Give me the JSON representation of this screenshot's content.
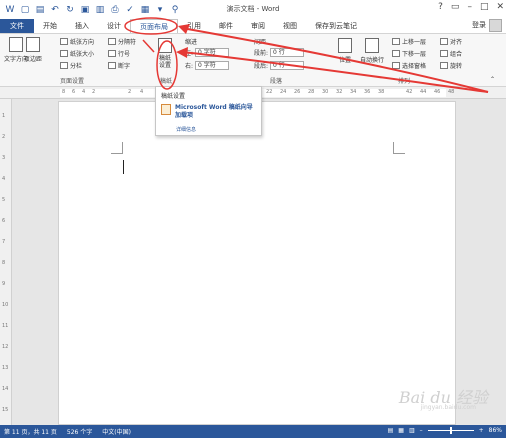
{
  "window": {
    "title": "演示文档 - Word",
    "login": "登录"
  },
  "tabs": [
    "文件",
    "开始",
    "插入",
    "设计",
    "页面布局",
    "引用",
    "邮件",
    "审阅",
    "视图",
    "保存到云笔记"
  ],
  "ribbon": {
    "text_direction": "文字方向",
    "margins": "页边距",
    "orientation": "纸张方向",
    "size": "纸张大小",
    "columns": "分栏",
    "breaks": "分隔符",
    "line_numbers": "行号",
    "hyphenation": "断字",
    "page_setup_group": "页面设置",
    "draft_setting_label": "稿纸\n设置",
    "draft_group": "稿纸",
    "indent_title": "缩进",
    "spacing_title": "间距",
    "left_label": "左:",
    "right_label": "右:",
    "before_label": "段前:",
    "after_label": "段后:",
    "left_value": "0 字符",
    "right_value": "0 字符",
    "before_value": "0 行",
    "after_value": "0 行",
    "paragraph_group": "段落",
    "position": "位置",
    "wrap": "自动换行",
    "forward": "上移一层",
    "backward": "下移一层",
    "selection_pane": "选择窗格",
    "align": "对齐",
    "group": "组合",
    "rotate": "旋转",
    "arrange_group": "排列"
  },
  "ruler": {
    "h_numbers": [
      "8",
      "6",
      "4",
      "2",
      "2",
      "4",
      "22",
      "24",
      "26",
      "28",
      "30",
      "32",
      "34",
      "36",
      "38",
      "42",
      "44",
      "46",
      "48"
    ],
    "v_numbers": [
      "1",
      "2",
      "3",
      "4",
      "5",
      "6",
      "7",
      "8",
      "9",
      "10",
      "11",
      "12",
      "13",
      "14",
      "15"
    ]
  },
  "dropdown": {
    "title": "稿纸设置",
    "item_line1": "Microsoft Word 稿纸向导",
    "item_line2": "加载项",
    "link": "详细信息"
  },
  "statusbar": {
    "page": "第 11 页，共 11 页",
    "words": "526 个字",
    "lang": "中文(中国)",
    "zoom": "86%"
  },
  "watermark": {
    "main": "Bai du 经验",
    "sub": "jingyan.baidu.com"
  },
  "colors": {
    "accent": "#2b579a",
    "annotation": "#e53935"
  }
}
